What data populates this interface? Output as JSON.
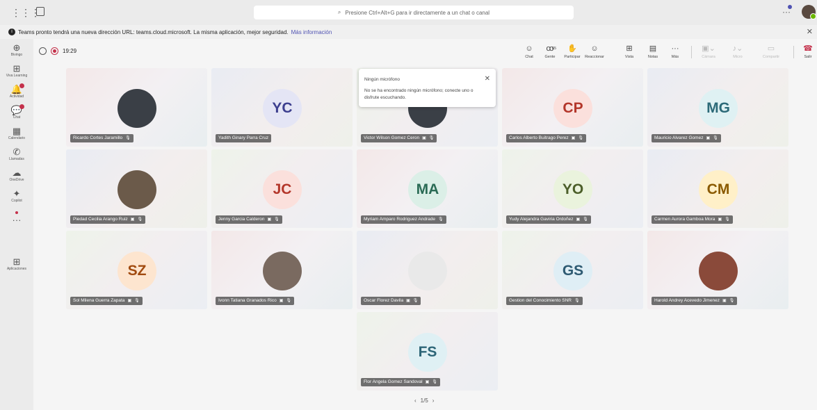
{
  "topbar": {
    "grid_icon": "⋮⋮⋮",
    "search_placeholder": "Presione Ctrl+Alt+G para ir directamente a un chat o canal",
    "more_icon": "···"
  },
  "banner": {
    "text": "Teams pronto tendrá una nueva dirección URL: teams.cloud.microsoft. La misma aplicación, mejor seguridad.",
    "link": "Más información"
  },
  "rail": [
    {
      "label": "Bivingo",
      "icon": "⊕"
    },
    {
      "label": "Viva Learning",
      "icon": "⊞"
    },
    {
      "label": "Actividad",
      "icon": "🔔"
    },
    {
      "label": "Chat",
      "icon": "💬"
    },
    {
      "label": "Calendario",
      "icon": "▦"
    },
    {
      "label": "Llamadas",
      "icon": "✆"
    },
    {
      "label": "OneDrive",
      "icon": "☁"
    },
    {
      "label": "Copilot",
      "icon": "✦"
    },
    {
      "label": "",
      "icon": "···"
    },
    {
      "label": "Aplicaciones",
      "icon": "⊞"
    }
  ],
  "call": {
    "time": "19:29",
    "controls": {
      "chat": "Chat",
      "people": "Gente",
      "people_count": "65",
      "raise": "Participar",
      "react": "Reaccionar",
      "view": "Vista",
      "notes": "Notas",
      "more": "Más",
      "camera": "Cámara",
      "mic": "Micro",
      "share": "Compartir",
      "leave": "Salir"
    }
  },
  "popup": {
    "title": "Ningún micrófono",
    "message": "No se ha encontrado ningún micrófono; conecte uno o disfrute escuchando."
  },
  "participants": [
    {
      "name": "Ricardo Cortes Jaramillo",
      "initials": "",
      "photo": true
    },
    {
      "name": "Yadith Ginary Parra Cruz",
      "initials": "YC",
      "color": "#e4e5f5",
      "text": "#3d3f8f"
    },
    {
      "name": "Victor Wilson Gomez Ceron",
      "initials": "",
      "photo": true
    },
    {
      "name": "Carlos Alberto Buitrago Perez",
      "initials": "CP",
      "color": "#fbe0dc",
      "text": "#b3362a"
    },
    {
      "name": "Mauricio Alvarez Gomez",
      "initials": "MG",
      "color": "#dff1f3",
      "text": "#2c6a78"
    },
    {
      "name": "Piedad Cecilia Arango Ruiz",
      "initials": "",
      "photo": true
    },
    {
      "name": "Jenny Garcia Calderon",
      "initials": "JC",
      "color": "#fbe0dc",
      "text": "#b3362a"
    },
    {
      "name": "Myriam Amparo Rodriguez Andrade",
      "initials": "MA",
      "color": "#dbefe7",
      "text": "#2a6b55"
    },
    {
      "name": "Yudy Alejandra Gaviria Ordoñez",
      "initials": "YO",
      "color": "#eaf3dd",
      "text": "#4c5f2a"
    },
    {
      "name": "Carmen Aurora Gamboa Mora",
      "initials": "CM",
      "color": "#fff0c8",
      "text": "#8a5a00"
    },
    {
      "name": "Sol Milena Guerra Zapata",
      "initials": "SZ",
      "color": "#fde5cf",
      "text": "#a14b10"
    },
    {
      "name": "Ivonn Tatiana Granados Rico",
      "initials": "",
      "photo": true
    },
    {
      "name": "Oscar Florez Davila",
      "initials": "",
      "photo": true
    },
    {
      "name": "Gestion del Conocimiento SNR",
      "initials": "GS",
      "color": "#dfeef5",
      "text": "#2e5a72"
    },
    {
      "name": "Harold Andrey Acevedo Jimenez",
      "initials": "",
      "photo": true
    },
    {
      "name": "Flor Angela Gomez Sandoval",
      "initials": "FS",
      "color": "#dff0f4",
      "text": "#2d6577"
    }
  ],
  "pager": {
    "prev": "‹",
    "label": "1/5",
    "next": "›"
  }
}
